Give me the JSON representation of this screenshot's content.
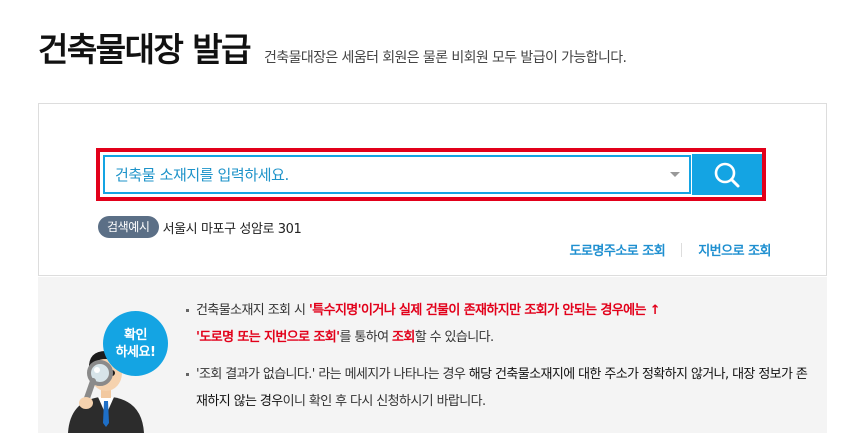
{
  "header": {
    "title": "건축물대장 발급",
    "description": "건축물대장은 세움터 회원은 물론 비회원 모두 발급이 가능합니다."
  },
  "search": {
    "placeholder": "건축물 소재지를 입력하세요.",
    "value": "",
    "button_icon": "search-icon",
    "example_badge": "검색예시",
    "example_text": "서울시 마포구 성암로 301"
  },
  "lookup_links": {
    "road_address": "도로명주소로 조회",
    "lot_number": "지번으로 조회"
  },
  "notice": {
    "bubble_line1": "확인",
    "bubble_line2": "하세요!",
    "item1": {
      "text1": "건축물소재지 조회 시 ",
      "highlight1": "'특수지명'이거나 실제 건물이 존재하지만 조회가 안되는 경우에는 ↑",
      "highlight2": "'도로명 또는 지번으로 조회'",
      "text2": "를 통하여 ",
      "highlight3": "조회",
      "text3": "할 수 있습니다."
    },
    "item2": {
      "text1": "'조회 결과가 없습니다.' 라는 메세지가 나타나는 경우 ",
      "highlight1": "해당 건축물소재지에 대한 주소가 정확하지 않거나, 대장 정보가 존재하지 않는 경우",
      "text2": "이니 확인 후 다시 신청하시기 바랍니다."
    }
  },
  "colors": {
    "accent_blue": "#14a4e3",
    "highlight_red": "#e2001a",
    "badge_gray": "#5b6f86",
    "link_blue": "#1e8fd0"
  }
}
